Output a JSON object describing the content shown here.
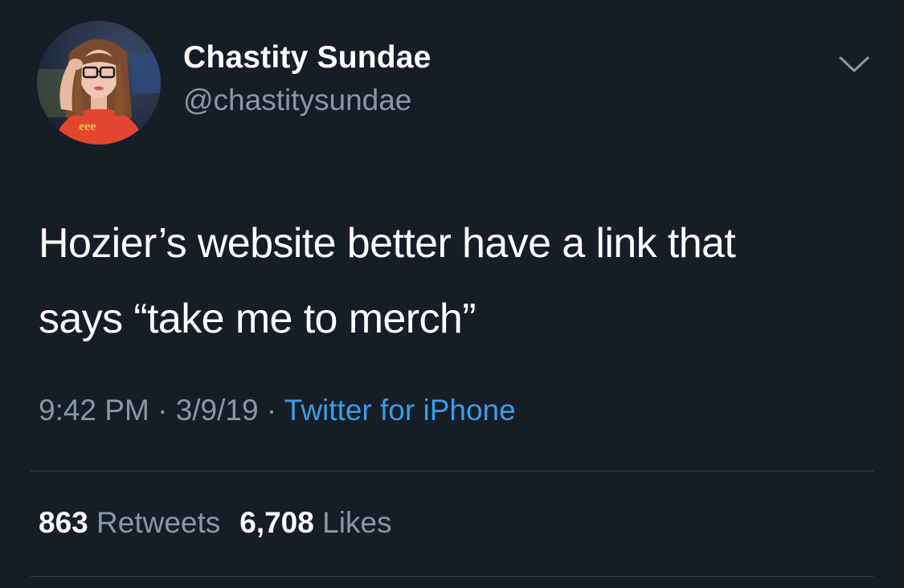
{
  "user": {
    "display_name": "Chastity Sundae",
    "handle": "@chastitysundae"
  },
  "tweet": {
    "lines": [
      "Hozier’s website better have a link that",
      "says “take me to merch”"
    ]
  },
  "meta": {
    "time": "9:42 PM",
    "sep1": " · ",
    "date": "3/9/19",
    "sep2": " · ",
    "source": "Twitter for iPhone"
  },
  "stats": {
    "retweets_count": "863",
    "retweets_label": "Retweets",
    "likes_count": "6,708",
    "likes_label": "Likes"
  },
  "icons": {
    "menu": "chevron-down-icon"
  },
  "colors": {
    "background": "#161d27",
    "secondary_text": "#8899a6",
    "link": "#3d9ce6",
    "divider": "#38444d"
  }
}
